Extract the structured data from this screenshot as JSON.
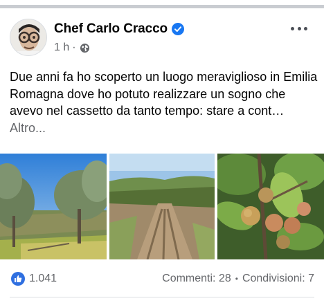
{
  "post": {
    "author": "Chef Carlo Cracco",
    "time": "1 h",
    "meta_separator": "·",
    "text": "Due anni fa ho scoperto un luogo meraviglioso in Emilia Romagna dove ho potuto realizzare un sogno che avevo nel cassetto da tanto tempo: stare a cont…",
    "see_more": "Altro...",
    "verified": true,
    "audience_icon": "globe-icon"
  },
  "stats": {
    "likes": "1.041",
    "comments": "Commenti: 28",
    "separator": "•",
    "shares": "Condivisioni: 7"
  },
  "photos": [
    {
      "subject": "olive-trees-hillside"
    },
    {
      "subject": "plowed-field-rows"
    },
    {
      "subject": "apricots-on-branch"
    }
  ],
  "colors": {
    "like_blue": "#2f6fe0",
    "verified_blue": "#1877f2",
    "secondary_text": "#65676b"
  }
}
